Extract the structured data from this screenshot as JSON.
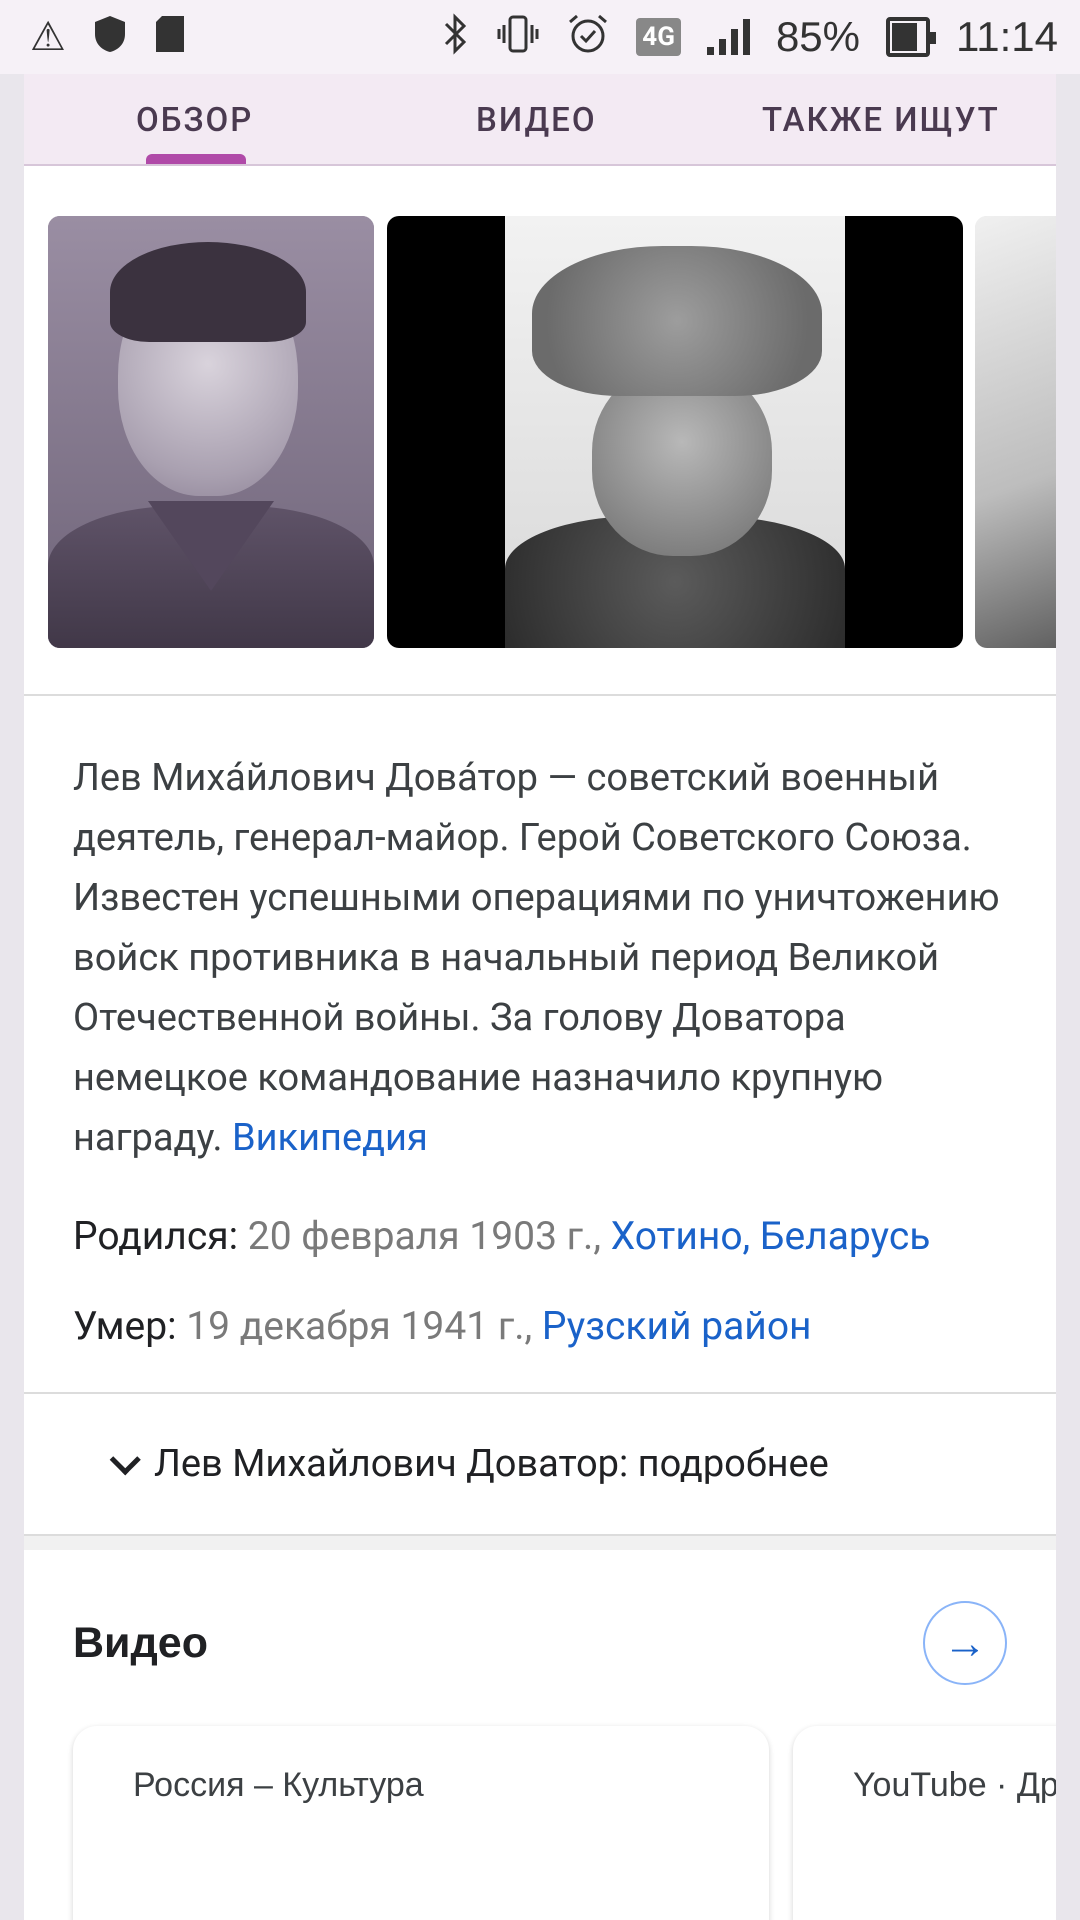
{
  "status_bar": {
    "icons_left": [
      "warning-icon",
      "shield-icon",
      "sd-card-icon"
    ],
    "icons_right": [
      "bluetooth-icon",
      "vibrate-icon",
      "alarm-icon"
    ],
    "network": "4G",
    "battery": "85%",
    "time": "11:14"
  },
  "tabs": [
    {
      "label": "ОБЗОР",
      "active": true
    },
    {
      "label": "ВИДЕО",
      "active": false
    },
    {
      "label": "ТАКЖЕ ИЩУТ",
      "active": false
    }
  ],
  "description": {
    "text": "Лев Миха́йлович Дова́тор — советский военный деятель, генерал-майор. Герой Советского Союза. Известен успешными операциями по уничтожению войск противника в начальный период Великой Отечественной войны. За голову Доватора немецкое командование назначило крупную награду.",
    "source_link": "Википедия"
  },
  "facts": {
    "born": {
      "label": "Родился:",
      "date": "20 февраля 1903 г.,",
      "place": "Хотино, Беларусь"
    },
    "died": {
      "label": "Умер:",
      "date": "19 декабря 1941 г.,",
      "place": "Рузский район"
    }
  },
  "expand": {
    "label": "Лев Михайлович Доватор: подробнее"
  },
  "videos": {
    "title": "Видео",
    "cards": [
      {
        "source": "Россия – Культура"
      },
      {
        "source": "YouTube · Дру"
      }
    ]
  },
  "colors": {
    "accent": "#b04aa8",
    "link": "#1a62c9",
    "tab_bg": "#f3eaf3"
  }
}
